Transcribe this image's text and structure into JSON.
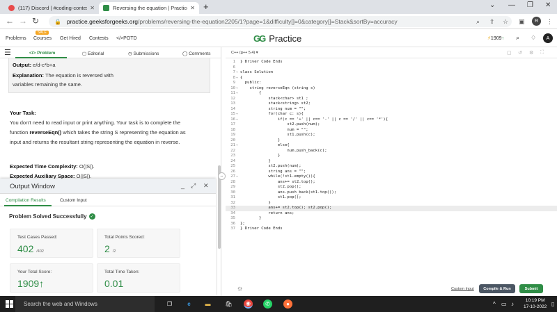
{
  "browser": {
    "tabs": [
      {
        "label": "(117) Discord | #coding-contests",
        "active": false
      },
      {
        "label": "Reversing the equation | Practice",
        "active": true
      }
    ],
    "url_host": "practice.geeksforgeeks.org",
    "url_rest": "/problems/reversing-the-equation2205/1?page=1&difficulty[]=0&category[]=Stack&sortBy=accuracy",
    "profile_initial": "R"
  },
  "site": {
    "nav": {
      "problems": "Problems",
      "courses": "Courses",
      "courses_badge": "SALE",
      "got_hired": "Get Hired",
      "contests": "Contests",
      "potd": "POTD"
    },
    "logo_mark": "GG",
    "logo_text": "Practice",
    "streak": "1909",
    "avatar_initial": "A"
  },
  "problem": {
    "tabs": {
      "problem": "Problem",
      "editorial": "Editorial",
      "submissions": "Submissions",
      "comments": "Comments"
    },
    "output_label": "Output:",
    "output_value": "e/d-c*b+a",
    "explanation_label": "Explanation:",
    "explanation_line1": "The equation is reversed with",
    "explanation_line2": "variables remaining the same.",
    "task_heading": "Your Task:",
    "task_line1": "You don't need to read input or print anything. Your task is to complete the",
    "task_line2_pre": "function",
    "task_line2_fn": "reverseEqn()",
    "task_line2_post": "which takes the string S representing the equation as",
    "task_line3": "input and returns the resultant string representing the equation in reverse.",
    "time_label": "Expected Time Complexity:",
    "time_value": "O(|S|).",
    "space_label": "Expected Auxiliary Space:",
    "space_value": "O(|S|)."
  },
  "output_window": {
    "title": "Output Window",
    "tabs": {
      "compilation": "Compilation Results",
      "custom": "Custom Input"
    },
    "status": "Problem Solved Successfully",
    "cards": {
      "test_cases_label": "Test Cases Passed:",
      "test_cases_value": "402",
      "test_cases_total": "/402",
      "points_label": "Total Points Scored:",
      "points_value": "2",
      "points_total": "/2",
      "score_label": "Your Total Score:",
      "score_value": "1909",
      "time_label": "Total Time Taken:",
      "time_value": "0.01"
    }
  },
  "editor": {
    "language": "C++ (g++ 5.4)",
    "custom_input": "Custom Input",
    "compile_run": "Compile & Run",
    "submit": "Submit",
    "line_numbers": [
      "1",
      "6",
      "7",
      "8",
      "9",
      "10",
      "11",
      "12",
      "13",
      "14",
      "15",
      "16",
      "17",
      "18",
      "19",
      "20",
      "21",
      "22",
      "23",
      "24",
      "25",
      "26",
      "27",
      "28",
      "29",
      "30",
      "31",
      "32",
      "33",
      "34",
      "35",
      "36",
      "37"
    ],
    "lines": [
      "} Driver Code Ends",
      "",
      "class Solution",
      "{",
      "  public:",
      "    string reverseEqn (string s)",
      "        {",
      "            stack<char> st1 ;",
      "            stack<string> st2;",
      "            string num = \"\";",
      "            for(char c: s){",
      "                if(c == '+' || c== '-' || c == '/' || c== '*'){",
      "                    st2.push(num);",
      "                    num = \"\";",
      "                    st1.push(c);",
      "                }",
      "                else{",
      "                    num.push_back(c);",
      "                }",
      "            }",
      "            st2.push(num);",
      "            string ans = \"\";",
      "            while(!st1.empty()){",
      "                ans+= st2.top();",
      "                st2.pop();",
      "                ans.push_back(st1.top());",
      "                st1.pop();",
      "            }",
      "            ans+= st2.top(); st2.pop();",
      "            return ans;",
      "        }",
      "};",
      "} Driver Code Ends"
    ]
  },
  "taskbar": {
    "search_placeholder": "Search the web and Windows",
    "time": "10:19 PM",
    "date": "17-10-2022"
  }
}
